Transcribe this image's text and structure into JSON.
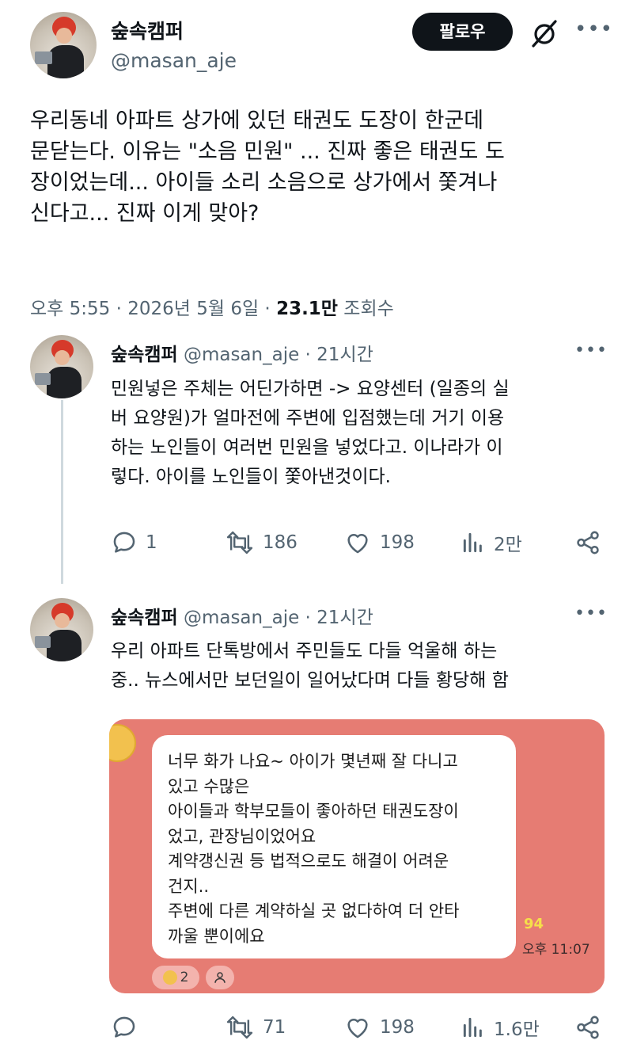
{
  "main_post": {
    "display_name": "숲속캠퍼",
    "handle": "@masan_aje",
    "follow_label": "팔로우",
    "text_lines": [
      "우리동네 아파트 상가에 있던 태권도 도장이 한군데",
      "문닫는다. 이유는 \"소음 민원\" ... 진짜 좋은 태권도 도",
      "장이었는데... 아이들 소리 소음으로 상가에서 쫓겨나",
      "신다고... 진짜 이게 맞아?"
    ],
    "meta_time": "오후 5:55 · 2026년 5월 6일 ·",
    "views_count": "23.1만",
    "views_label": "조회수"
  },
  "replies": [
    {
      "display_name": "숲속캠퍼",
      "handle_time": "@masan_aje · 21시간",
      "text_lines": [
        "민원넣은 주체는 어딘가하면 -> 요양센터 (일종의 실",
        "버 요양원)가 얼마전에 주변에 입점했는데 거기 이용",
        "하는 노인들이 여러번 민원을 넣었다고. 이나라가 이",
        "렇다. 아이를 노인들이 쫓아낸것이다."
      ],
      "actions": {
        "replies": "1",
        "reposts": "186",
        "likes": "198",
        "views": "2만"
      }
    },
    {
      "display_name": "숲속캠퍼",
      "handle_time": "@masan_aje · 21시간",
      "text_lines": [
        "우리 아파트 단톡방에서 주민들도 다들 억울해 하는",
        "중.. 뉴스에서만 보던일이 일어났다며 다들 황당해 함"
      ],
      "chat": {
        "message_lines": [
          "너무 화가 나요~ 아이가 몇년째 잘 다니고",
          "있고 수많은",
          "아이들과 학부모들이 좋아하던 태권도장이",
          "었고, 관장님이었어요",
          "계약갱신권 등 법적으로도 해결이 어려운",
          "건지..",
          "주변에 다른 계약하실 곳 없다하여 더 안타",
          "까울 뿐이에요"
        ],
        "unread_count": "94",
        "time": "오후 11:07",
        "reaction_count": "2"
      },
      "actions": {
        "replies": "",
        "reposts": "71",
        "likes": "198",
        "views": "1.6만"
      }
    }
  ],
  "colors": {
    "chat_background": "#e67c73",
    "text": "#0f1419",
    "muted": "#536471"
  }
}
